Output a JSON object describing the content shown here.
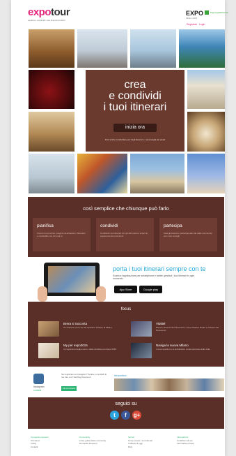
{
  "header": {
    "brand_part1": "expo",
    "brand_part2": "tour",
    "tagline": "esplora e condividi i tuoi itinerari preferiti",
    "expo_logo": "EXPO",
    "expo_sub": "Milano 2015",
    "partner_label": "PaginegiallePartner",
    "links": "Registrati · Login"
  },
  "hero": {
    "title_line1": "crea",
    "title_line2": "e condividi",
    "title_line3": "i tuoi itinerari",
    "cta": "inizia ora",
    "note": "Puoi anche condividere per degli itinerari e i suoi luoghi più amati"
  },
  "how": {
    "title": "così semplice che chiunque può farlo",
    "cards": [
      {
        "title": "pianifica",
        "desc": "Crea il tuo percorso: scegli le destinazioni, l'itinerario e condividilo con chi vuoi tu."
      },
      {
        "title": "condividi",
        "desc": "Condividi i tuoi itinerari con gli altri utenti e scopri le esperienze dei tuoi amici."
      },
      {
        "title": "partecipa",
        "desc": "Vota gli itinerari e partecipa alla vita della community con i tuoi consigli."
      }
    ]
  },
  "app": {
    "title": "porta i tuoi itinerari sempre con te",
    "desc": "Scarica l'applicazione per smartphone e tablet: gestisci i tuoi itinerari in ogni momento.",
    "appstore": "App Store",
    "googleplay": "Google play"
  },
  "focus": {
    "title": "focus",
    "items": [
      {
        "title": "Brera si racconta",
        "desc": "Un itinerario tra le vie del quartiere artistico di Milano."
      },
      {
        "title": "Vitaltel",
        "desc": "Ebook e itinerari del Novecento, come Palazzo Reale e il Museo del Novecento."
      },
      {
        "title": "My per expo2015",
        "desc": "Il programma degli eventi e delle iniziative per Expo 2015."
      },
      {
        "title": "Naviga la nuova Milano",
        "desc": "I nuovi quartieri e le architetture contemporanee della città."
      }
    ]
  },
  "instagram": {
    "label": "Instagram",
    "sub": "contest",
    "desc": "Sei registrato su Instagram? Scatta e condividi le tue foto con l'hashtag #expotour.",
    "button": "Vai al contest",
    "photos_label": "#expotour"
  },
  "social": {
    "title": "seguici su",
    "twitter": "t",
    "facebook": "f",
    "google": "g+"
  },
  "footer": {
    "cols": [
      {
        "head": "Il progetto expotour",
        "l1": "Chi siamo",
        "l2": "Il blog",
        "l3": "Contatti"
      },
      {
        "head": "Community",
        "l1": "Linee guida della community",
        "l2": "Domande frequenti"
      },
      {
        "head": "Servizi",
        "l1": "Come creare i tuoi itinerari",
        "l2": "Il Milano di oggi",
        "l3": "FAQ"
      },
      {
        "head": "Informazioni",
        "l1": "Condizioni di uso",
        "l2": "Informativa privacy"
      }
    ]
  },
  "colors": {
    "accent": "#e3257b",
    "panel": "#5a2f27",
    "hero": "#6b3a2f",
    "link_blue": "#25a9d6",
    "green": "#2fb574"
  }
}
